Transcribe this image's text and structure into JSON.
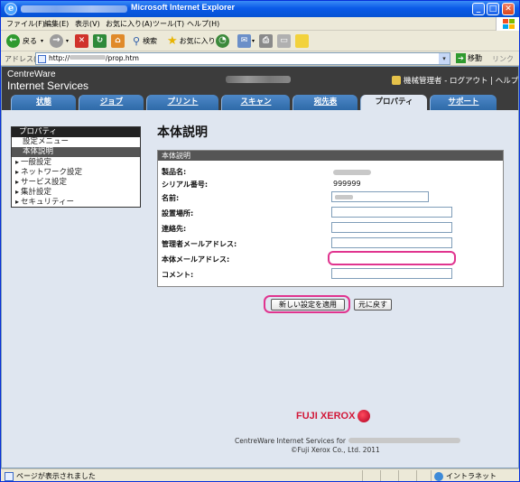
{
  "window": {
    "title": "Microsoft Internet Explorer",
    "controls": {
      "minimize": "_",
      "maximize": "□",
      "close": "✕"
    }
  },
  "menubar": {
    "items": [
      "ファイル(F)",
      "編集(E)",
      "表示(V)",
      "お気に入り(A)",
      "ツール(T)",
      "ヘルプ(H)"
    ]
  },
  "toolbar": {
    "back_label": "戻る",
    "search_label": "検索",
    "favorites_label": "お気に入り"
  },
  "address": {
    "label": "アドレス(D)",
    "url_prefix": "http://",
    "url_suffix": "/prop.htm",
    "go_label": "移動",
    "links_label": "リンク"
  },
  "header": {
    "brand_line1": "CentreWare",
    "brand_line2": "Internet Services",
    "user_text": "機械管理者 - ログアウト | ヘルプ..."
  },
  "tabs": [
    {
      "label": "状態"
    },
    {
      "label": "ジョブ"
    },
    {
      "label": "プリント"
    },
    {
      "label": "スキャン"
    },
    {
      "label": "宛先表"
    },
    {
      "label": "プロパティ"
    },
    {
      "label": "サポート"
    }
  ],
  "sidebar": {
    "header": "プロパティ",
    "items": [
      {
        "label": "設定メニュー"
      },
      {
        "label": "本体説明"
      },
      {
        "label": "一般設定"
      },
      {
        "label": "ネットワーク設定"
      },
      {
        "label": "サービス設定"
      },
      {
        "label": "集計設定"
      },
      {
        "label": "セキュリティー"
      }
    ]
  },
  "main": {
    "page_title": "本体説明",
    "panel_title": "本体説明",
    "fields": {
      "product_name_label": "製品名:",
      "serial_label": "シリアル番号:",
      "serial_value": "999999",
      "name_label": "名前:",
      "location_label": "設置場所:",
      "contact_label": "連絡先:",
      "admin_email_label": "管理者メールアドレス:",
      "device_email_label": "本体メールアドレス:",
      "comment_label": "コメント:"
    },
    "apply_button": "新しい設定を適用",
    "reset_button": "元に戻す"
  },
  "footer": {
    "logo_text": "FUJI XEROX",
    "line1_prefix": "CentreWare Internet Services for",
    "line2": "©Fuji Xerox Co., Ltd. 2011"
  },
  "statusbar": {
    "status_text": "ページが表示されました",
    "zone_text": "イントラネット"
  },
  "colors": {
    "accent_highlight": "#e0348f",
    "tab_blue": "#2e6aa8",
    "header_dark": "#3c3c3c",
    "brand_red": "#d2193a"
  }
}
